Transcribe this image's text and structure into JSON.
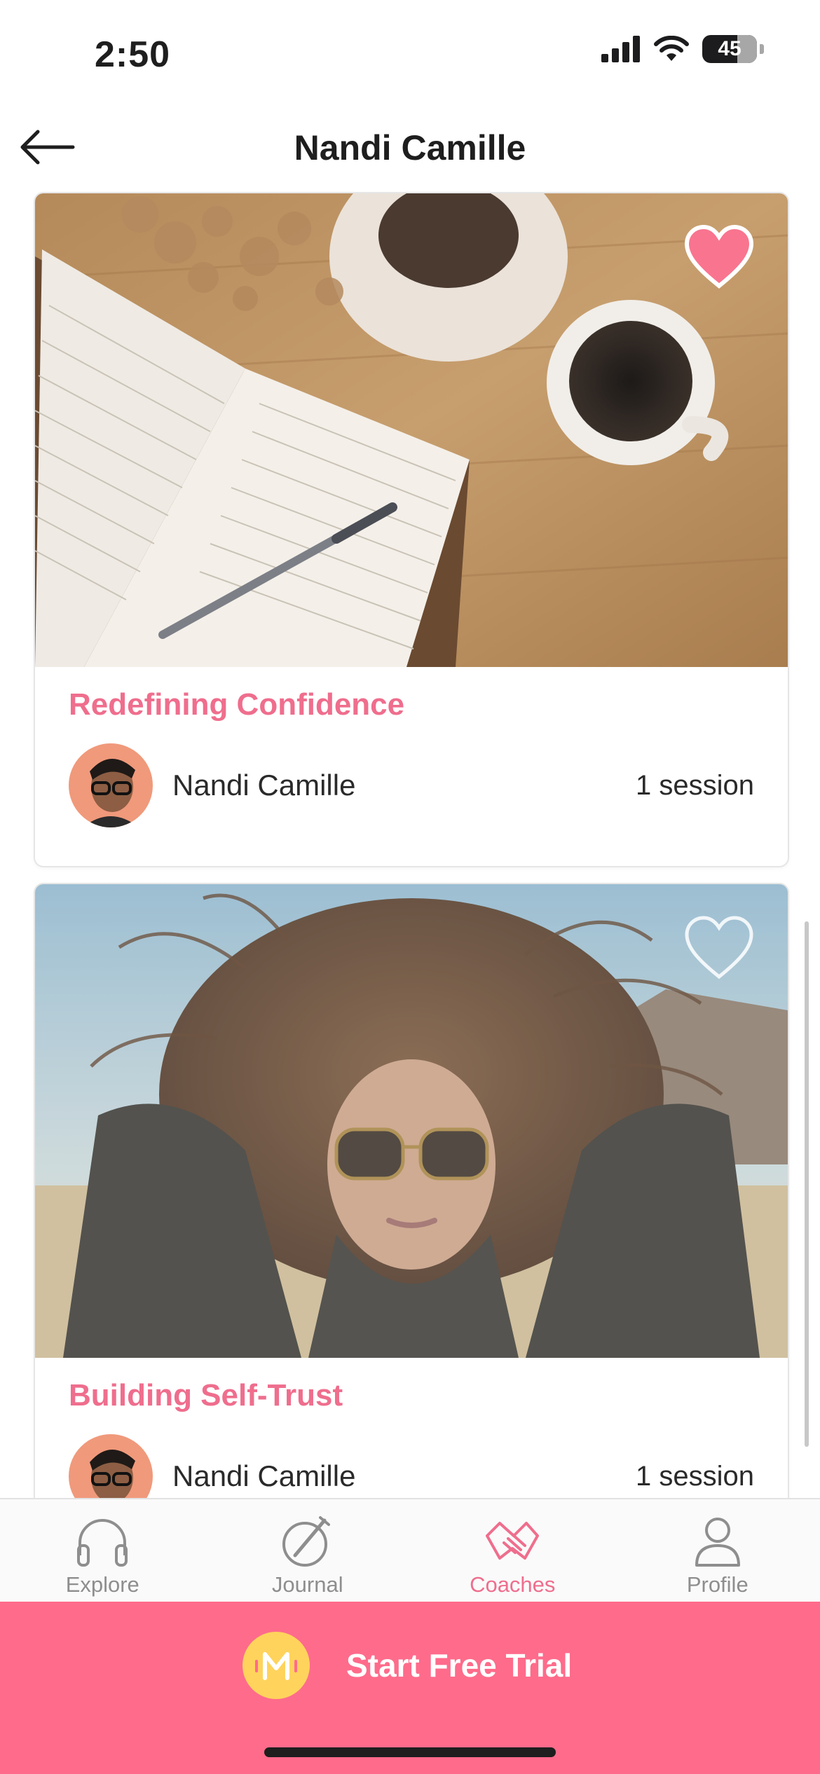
{
  "status_bar": {
    "time": "2:50",
    "battery": "45",
    "icons": [
      "signal-icon",
      "wifi-icon",
      "battery-icon"
    ]
  },
  "nav": {
    "title": "Nandi Camille",
    "back_icon": "back-arrow-icon"
  },
  "cards": [
    {
      "title": "Redefining Confidence",
      "author": "Nandi Camille",
      "sessions": "1 session",
      "favorited": true,
      "image": "journal-coffee-photo"
    },
    {
      "title": "Building Self-Trust",
      "author": "Nandi Camille",
      "sessions": "1 session",
      "favorited": false,
      "image": "woman-windblown-hair-photo"
    }
  ],
  "tabs": [
    {
      "label": "Explore",
      "icon": "headphones-icon",
      "active": false
    },
    {
      "label": "Journal",
      "icon": "pencil-circle-icon",
      "active": false
    },
    {
      "label": "Coaches",
      "icon": "handshake-icon",
      "active": true
    },
    {
      "label": "Profile",
      "icon": "person-icon",
      "active": false
    }
  ],
  "cta": {
    "label": "Start Free Trial",
    "logo_letter": "M"
  },
  "colors": {
    "accent": "#ef6d8d",
    "cta_bg": "#fe6b8b",
    "logo_bg": "#ffd35c"
  }
}
